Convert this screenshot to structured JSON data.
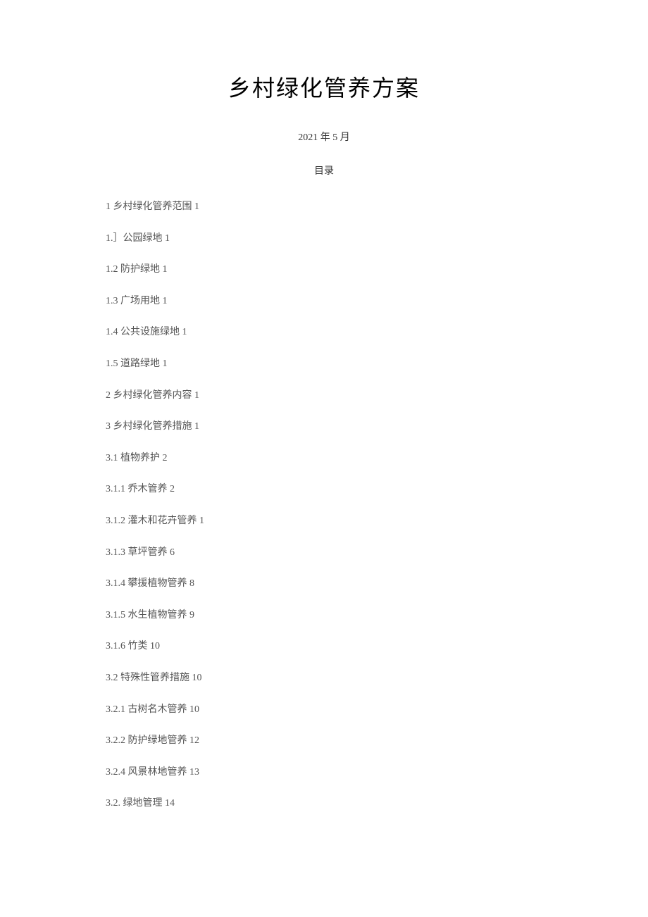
{
  "title": "乡村绿化管养方案",
  "date": "2021 年 5 月",
  "tocLabel": "目录",
  "tocItems": [
    "1 乡村绿化管养范围 1",
    "1.］公园绿地 1",
    "1.2 防护绿地 1",
    "1.3 广场用地 1",
    "1.4 公共设施绿地 1",
    "1.5 道路绿地 1",
    "2 乡村绿化管养内容 1",
    "3 乡村绿化管养措施 1",
    "3.1 植物养护 2",
    "3.1.1 乔木管养 2",
    "3.1.2 灌木和花卉管养 1",
    "3.1.3 草坪管养 6",
    "3.1.4 攀援植物管养 8",
    "3.1.5 水生植物管养 9",
    "3.1.6 竹类 10",
    "3.2 特殊性管养措施 10",
    "3.2.1 古树名木管养 10",
    "3.2.2 防护绿地管养 12",
    "3.2.4 风景林地管养 13",
    "3.2. 绿地管理 14"
  ]
}
